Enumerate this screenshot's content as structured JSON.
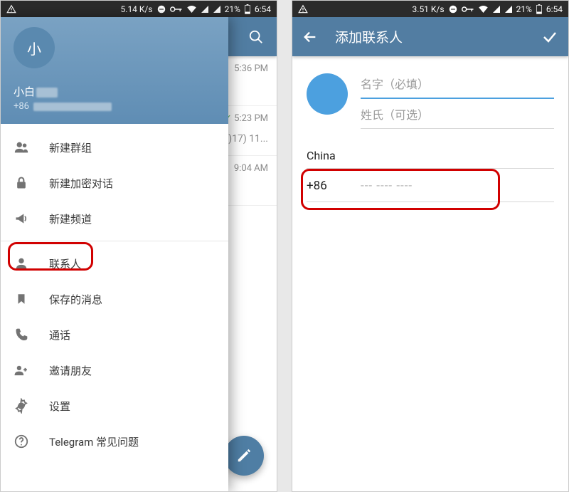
{
  "status": {
    "left_speed": "5.14 K/s",
    "right_speed": "3.51 K/s",
    "battery": "21%",
    "time": "6:54"
  },
  "left": {
    "drawer": {
      "avatar_letter": "小",
      "name": "小白",
      "phone_prefix": "+86",
      "items": [
        {
          "icon": "group-icon",
          "label": "新建群组"
        },
        {
          "icon": "lock-icon",
          "label": "新建加密对话"
        },
        {
          "icon": "megaphone-icon",
          "label": "新建频道"
        },
        {
          "icon": "contact-icon",
          "label": "联系人"
        },
        {
          "icon": "bookmark-icon",
          "label": "保存的消息"
        },
        {
          "icon": "phone-icon",
          "label": "通话"
        },
        {
          "icon": "invite-icon",
          "label": "邀请朋友"
        },
        {
          "icon": "settings-icon",
          "label": "设置"
        },
        {
          "icon": "help-icon",
          "label": "Telegram 常见问题"
        }
      ]
    },
    "bg_chats": {
      "row0_time": "5:36 PM",
      "row1_time": "5:23 PM",
      "row1_sub": ")17) 11...",
      "row2_time": "9:04 AM"
    }
  },
  "right": {
    "title": "添加联系人",
    "first_name_placeholder": "名字（必填）",
    "last_name_placeholder": "姓氏（可选）",
    "country": "China",
    "country_code": "+86",
    "phone_placeholder": "--- ---- ----"
  }
}
